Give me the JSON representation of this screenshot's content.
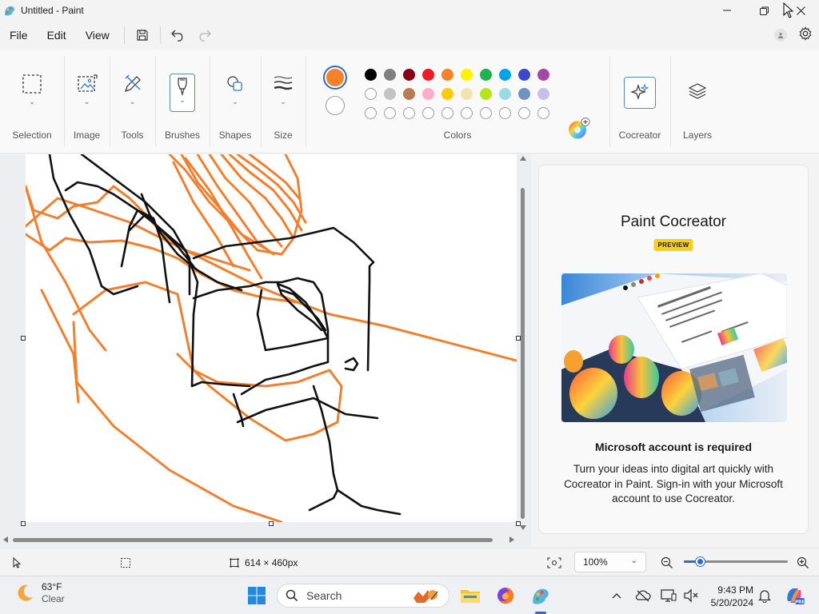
{
  "window": {
    "title": "Untitled - Paint"
  },
  "menu": {
    "file": "File",
    "edit": "Edit",
    "view": "View"
  },
  "ribbon": {
    "selection": "Selection",
    "image": "Image",
    "tools": "Tools",
    "brushes": "Brushes",
    "shapes": "Shapes",
    "size": "Size",
    "colors": "Colors",
    "cocreator": "Cocreator",
    "layers": "Layers"
  },
  "palette": {
    "primary": "#f5812a",
    "secondary": "#ffffff",
    "row1": [
      "#000000",
      "#7f7f7f",
      "#880015",
      "#ed1c24",
      "#f5812a",
      "#fff200",
      "#22b14c",
      "#00a2e8",
      "#3f48cc",
      "#a349a4"
    ],
    "row2": [
      "#ffffff",
      "#c3c3c3",
      "#b97a57",
      "#ffaec9",
      "#ffc90e",
      "#efe4b0",
      "#b5e61d",
      "#99d9ea",
      "#7092be",
      "#c8bfe7"
    ]
  },
  "cocreator_panel": {
    "title": "Paint Cocreator",
    "badge": "PREVIEW",
    "heading": "Microsoft account is required",
    "body": "Turn your ideas into digital art quickly with Cocreator in Paint. Sign-in with your Microsoft account to use Cocreator."
  },
  "status": {
    "canvas_size": "614 × 460px",
    "zoom": "100%",
    "zoom_level": 0.15
  },
  "taskbar": {
    "weather_temp": "63°F",
    "weather_cond": "Clear",
    "search": "Search",
    "time": "9:43 PM",
    "date": "5/20/2024"
  }
}
